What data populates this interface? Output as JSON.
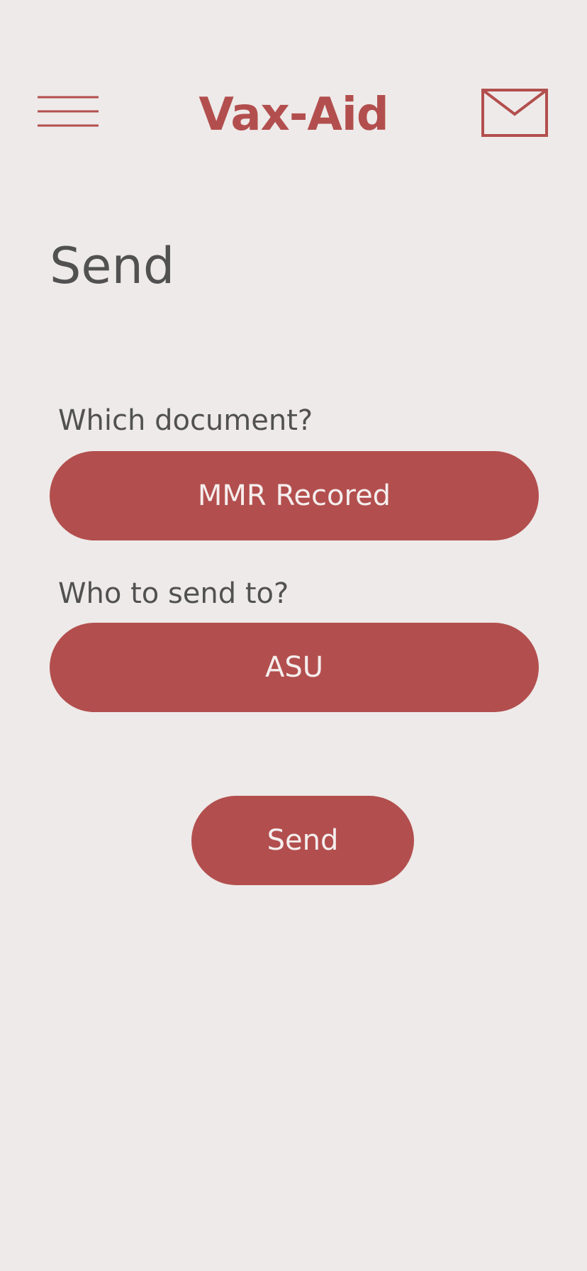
{
  "theme": {
    "accent": "#b24f4e",
    "background": "#eeeae9",
    "text": "#515151",
    "button_text": "#f5eeee"
  },
  "header": {
    "app_title": "Vax-Aid",
    "menu_icon": "hamburger-menu-icon",
    "mail_icon": "envelope-icon"
  },
  "page": {
    "title": "Send"
  },
  "form": {
    "document_label": "Which document?",
    "document_value": "MMR Recored",
    "recipient_label": "Who to send to?",
    "recipient_value": "ASU",
    "send_label": "Send"
  }
}
